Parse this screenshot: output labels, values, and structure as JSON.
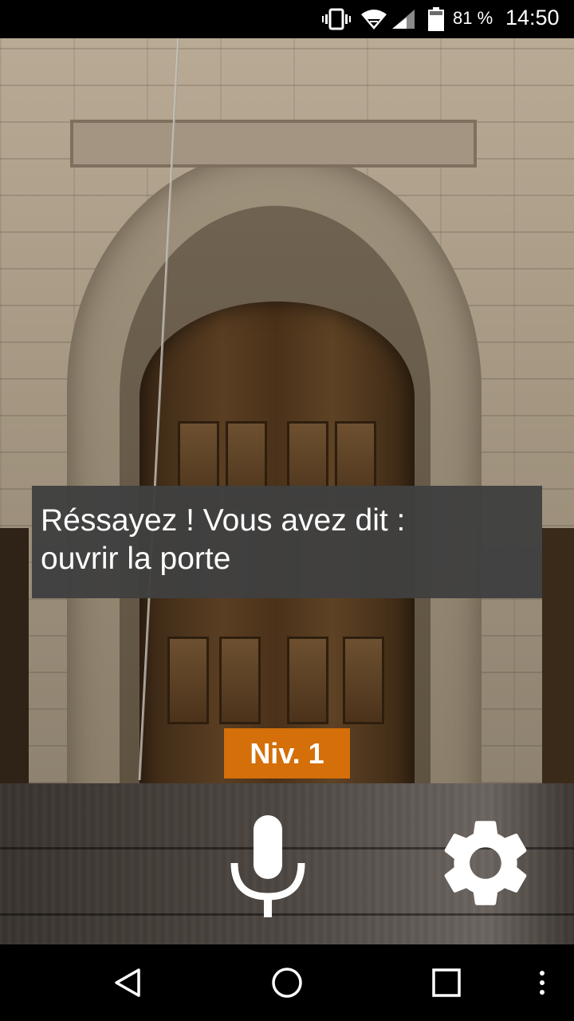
{
  "status_bar": {
    "battery_percent": "81 %",
    "time": "14:50",
    "icons": [
      "vibrate-icon",
      "wifi-icon",
      "signal-icon",
      "battery-icon"
    ]
  },
  "message": {
    "line1": "Réssayez ! Vous avez dit :",
    "line2": "ouvrir la porte"
  },
  "level": {
    "label": "Niv. 1"
  },
  "controls": {
    "icons": [
      "microphone-icon",
      "settings-gear-icon"
    ]
  },
  "nav_bar": {
    "icons": [
      "back-icon",
      "home-icon",
      "recent-apps-icon",
      "overflow-menu-icon"
    ]
  },
  "colors": {
    "level_badge": "#d46f0a",
    "message_bg": "#404040"
  }
}
